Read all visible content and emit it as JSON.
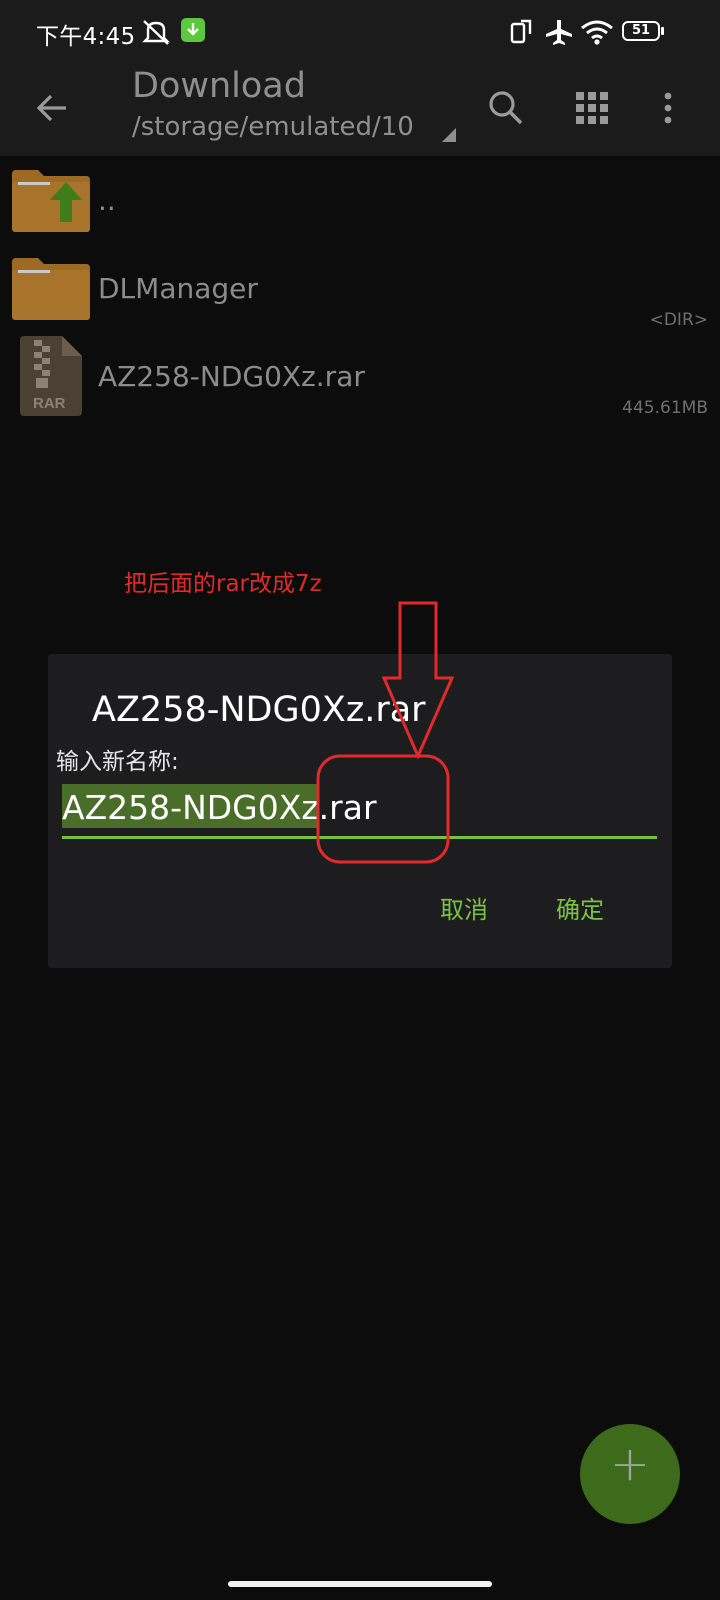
{
  "status_bar": {
    "time": "下午4:45",
    "battery": "51",
    "icons": [
      "alarm-off-icon",
      "download-notification-icon",
      "screen-rotate-icon",
      "airplane-mode-icon",
      "wifi-icon",
      "battery-icon"
    ]
  },
  "app_bar": {
    "title": "Download",
    "path": "/storage/emulated/10",
    "icons": [
      "back-arrow-icon",
      "search-icon",
      "grid-view-icon",
      "more-vert-icon"
    ]
  },
  "files": [
    {
      "name": "..",
      "meta": "",
      "icon": "folder-up-icon"
    },
    {
      "name": "DLManager",
      "meta": "<DIR>",
      "icon": "folder-icon"
    },
    {
      "name": "AZ258-NDG0Xz.rar",
      "meta": "445.61MB",
      "icon": "rar-file-icon"
    }
  ],
  "annotation": {
    "text": "把后面的rar改成7z",
    "color": "#e12b2b"
  },
  "rename_dialog": {
    "title": "AZ258-NDG0Xz.rar",
    "label": "输入新名称:",
    "input_value": "AZ258-NDG0Xz.rar",
    "selected_text": "AZ258-NDG0Xz",
    "cancel_label": "取消",
    "confirm_label": "确定",
    "accent_color": "#7bc242"
  },
  "fab": {
    "label": "+",
    "icon": "add-icon"
  }
}
